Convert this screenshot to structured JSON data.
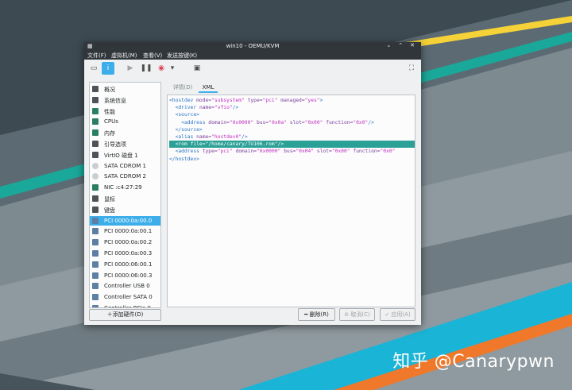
{
  "window": {
    "title": "win10 - OEMU/KVM"
  },
  "menubar": {
    "items": [
      "文件(F)",
      "虚拟机(M)",
      "查看(V)",
      "发送按键(K)"
    ]
  },
  "toolbar": {
    "icons": [
      "monitor-icon",
      "info-icon",
      "play-icon",
      "pause-icon",
      "power-icon",
      "dropdown-icon",
      "screens-icon",
      "fullscreen-icon"
    ]
  },
  "sidebar": {
    "items": [
      {
        "label": "概况",
        "icon": "overview-icon"
      },
      {
        "label": "系统信息",
        "icon": "system-info-icon"
      },
      {
        "label": "性能",
        "icon": "performance-icon"
      },
      {
        "label": "CPUs",
        "icon": "cpu-icon"
      },
      {
        "label": "内存",
        "icon": "memory-icon"
      },
      {
        "label": "引导选项",
        "icon": "boot-icon"
      },
      {
        "label": "VirtIO 磁盘 1",
        "icon": "disk-icon"
      },
      {
        "label": "SATA CDROM 1",
        "icon": "cdrom-icon"
      },
      {
        "label": "SATA CDROM 2",
        "icon": "cdrom-icon"
      },
      {
        "label": "NIC :c4:27:29",
        "icon": "nic-icon"
      },
      {
        "label": "鼠标",
        "icon": "mouse-icon"
      },
      {
        "label": "键盘",
        "icon": "keyboard-icon"
      },
      {
        "label": "PCI 0000:0a:00.0",
        "icon": "pci-icon"
      },
      {
        "label": "PCI 0000:0a:00.1",
        "icon": "pci-icon"
      },
      {
        "label": "PCI 0000:0a:00.2",
        "icon": "pci-icon"
      },
      {
        "label": "PCI 0000:0a:00.3",
        "icon": "pci-icon"
      },
      {
        "label": "PCI 0000:06:00.1",
        "icon": "pci-icon"
      },
      {
        "label": "PCI 0000:06:00.3",
        "icon": "pci-icon"
      },
      {
        "label": "Controller USB 0",
        "icon": "controller-icon"
      },
      {
        "label": "Controller SATA 0",
        "icon": "controller-icon"
      },
      {
        "label": "Controller PCIe 0",
        "icon": "controller-icon"
      }
    ],
    "selected_label": "PCI 0000:0a:00.0",
    "add_hardware": "添加硬件(D)"
  },
  "tabs": {
    "details": "详情(D)",
    "xml": "XML"
  },
  "xml_lines": [
    {
      "indent": "",
      "parts": [
        [
          "tag",
          "<hostdev "
        ],
        [
          "attr",
          "mode="
        ],
        [
          "val",
          "\"subsystem\""
        ],
        [
          "attr",
          " type="
        ],
        [
          "val",
          "\"pci\""
        ],
        [
          "attr",
          " managed="
        ],
        [
          "val",
          "\"yes\""
        ],
        [
          "tag",
          ">"
        ]
      ]
    },
    {
      "indent": "  ",
      "parts": [
        [
          "tag",
          "<driver "
        ],
        [
          "attr",
          "name="
        ],
        [
          "val",
          "\"vfio\""
        ],
        [
          "tag",
          "/>"
        ]
      ]
    },
    {
      "indent": "  ",
      "parts": [
        [
          "tag",
          "<source>"
        ]
      ]
    },
    {
      "indent": "    ",
      "parts": [
        [
          "tag",
          "<address "
        ],
        [
          "attr",
          "domain="
        ],
        [
          "val",
          "\"0x0000\""
        ],
        [
          "attr",
          " bus="
        ],
        [
          "val",
          "\"0x0a\""
        ],
        [
          "attr",
          " slot="
        ],
        [
          "val",
          "\"0x00\""
        ],
        [
          "attr",
          " function="
        ],
        [
          "val",
          "\"0x0\""
        ],
        [
          "tag",
          "/>"
        ]
      ]
    },
    {
      "indent": "  ",
      "parts": [
        [
          "tag",
          "</source>"
        ]
      ]
    },
    {
      "indent": "  ",
      "parts": [
        [
          "tag",
          "<alias "
        ],
        [
          "attr",
          "name="
        ],
        [
          "val",
          "\"hostdev0\""
        ],
        [
          "tag",
          "/>"
        ]
      ]
    },
    {
      "indent": "  ",
      "parts": [
        [
          "tag",
          "<rom "
        ],
        [
          "attr",
          "file="
        ],
        [
          "val",
          "\"/home/canary/TU106.rom\""
        ],
        [
          "tag",
          "/>"
        ]
      ],
      "highlight": true
    },
    {
      "indent": "  ",
      "parts": [
        [
          "tag",
          "<address "
        ],
        [
          "attr",
          "type="
        ],
        [
          "val",
          "\"pci\""
        ],
        [
          "attr",
          " domain="
        ],
        [
          "val",
          "\"0x0000\""
        ],
        [
          "attr",
          " bus="
        ],
        [
          "val",
          "\"0x04\""
        ],
        [
          "attr",
          " slot="
        ],
        [
          "val",
          "\"0x00\""
        ],
        [
          "attr",
          " function="
        ],
        [
          "val",
          "\"0x0\""
        ]
      ]
    },
    {
      "indent": "",
      "parts": [
        [
          "tag",
          "</hostdev>"
        ]
      ]
    }
  ],
  "buttons": {
    "remove": "删除(R)",
    "cancel": "取消(C)",
    "apply": "应用(A)"
  },
  "watermark": "知乎 @Canarypwn"
}
